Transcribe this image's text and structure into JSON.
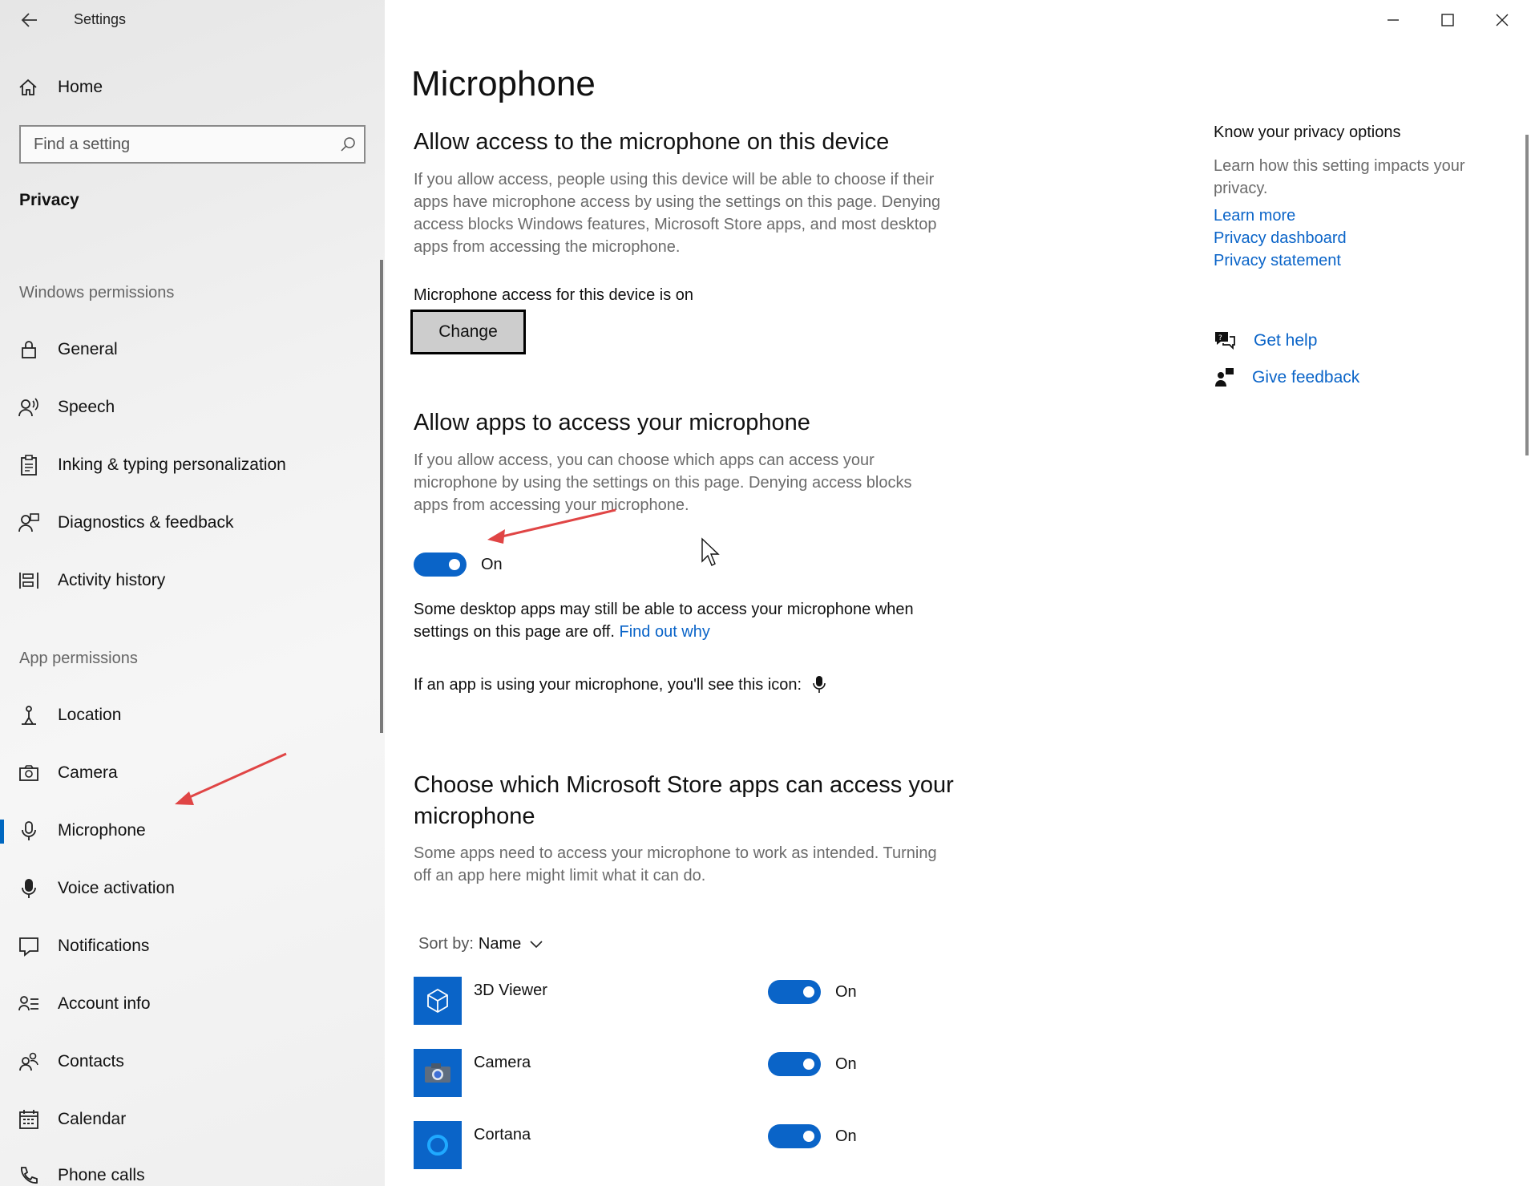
{
  "window": {
    "title": "Settings",
    "minimize_icon": "minimize-icon",
    "maximize_icon": "maximize-icon",
    "close_icon": "close-icon"
  },
  "sidebar": {
    "home_label": "Home",
    "search_placeholder": "Find a setting",
    "active_section": "Privacy",
    "windows_permissions_heading": "Windows permissions",
    "windows_permissions": [
      {
        "label": "General",
        "icon": "lock-icon"
      },
      {
        "label": "Speech",
        "icon": "speech-icon"
      },
      {
        "label": "Inking & typing personalization",
        "icon": "clipboard-icon"
      },
      {
        "label": "Diagnostics & feedback",
        "icon": "diagnostics-icon"
      },
      {
        "label": "Activity history",
        "icon": "activity-history-icon"
      }
    ],
    "app_permissions_heading": "App permissions",
    "app_permissions": [
      {
        "label": "Location",
        "icon": "location-icon"
      },
      {
        "label": "Camera",
        "icon": "camera-icon"
      },
      {
        "label": "Microphone",
        "icon": "microphone-icon",
        "active": true
      },
      {
        "label": "Voice activation",
        "icon": "voice-activation-icon"
      },
      {
        "label": "Notifications",
        "icon": "notifications-icon"
      },
      {
        "label": "Account info",
        "icon": "account-info-icon"
      },
      {
        "label": "Contacts",
        "icon": "contacts-icon"
      },
      {
        "label": "Calendar",
        "icon": "calendar-icon"
      },
      {
        "label": "Phone calls",
        "icon": "phone-icon"
      }
    ]
  },
  "main": {
    "page_title": "Microphone",
    "device_section": {
      "heading": "Allow access to the microphone on this device",
      "description": "If you allow access, people using this device will be able to choose if their apps have microphone access by using the settings on this page. Denying access blocks Windows features, Microsoft Store apps, and most desktop apps from accessing the microphone.",
      "status": "Microphone access for this device is on",
      "change_label": "Change"
    },
    "apps_section": {
      "heading": "Allow apps to access your microphone",
      "description": "If you allow access, you can choose which apps can access your microphone by using the settings on this page. Denying access blocks apps from accessing your microphone.",
      "toggle_state": "On",
      "note": "Some desktop apps may still be able to access your microphone when settings on this page are off.",
      "note_link": "Find out why",
      "icon_note": "If an app is using your microphone, you'll see this icon:"
    },
    "store_section": {
      "heading": "Choose which Microsoft Store apps can access your microphone",
      "description": "Some apps need to access your microphone to work as intended. Turning off an app here might limit what it can do.",
      "sort_label": "Sort by:",
      "sort_value": "Name",
      "apps": [
        {
          "name": "3D Viewer",
          "state": "On",
          "icon": "3d-viewer-icon"
        },
        {
          "name": "Camera",
          "state": "On",
          "icon": "camera-app-icon"
        },
        {
          "name": "Cortana",
          "state": "On",
          "icon": "cortana-icon"
        }
      ]
    }
  },
  "right_panel": {
    "heading": "Know your privacy options",
    "description": "Learn how this setting impacts your privacy.",
    "links": [
      "Learn more",
      "Privacy dashboard",
      "Privacy statement"
    ],
    "get_help": "Get help",
    "give_feedback": "Give feedback"
  },
  "colors": {
    "accent": "#0a64c8",
    "annotation_arrow": "#e04545"
  }
}
